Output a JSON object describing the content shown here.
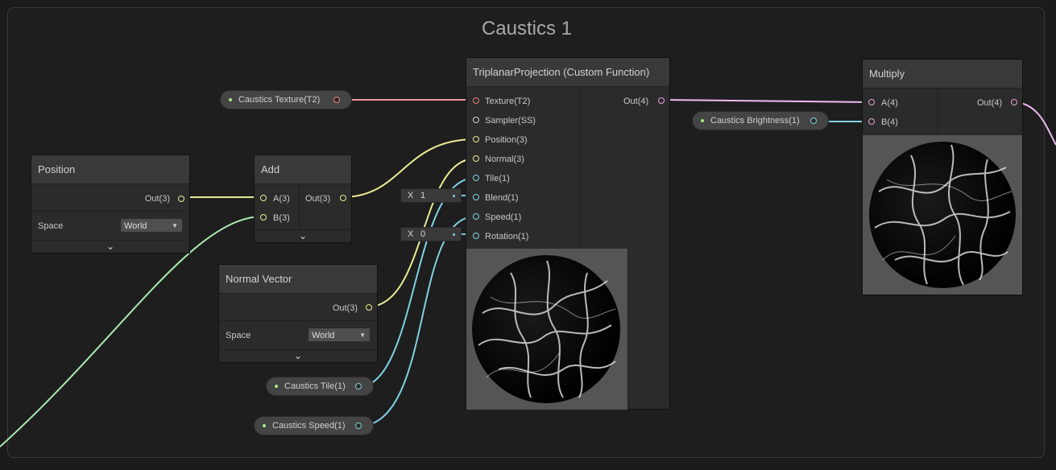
{
  "group": {
    "title": "Caustics 1"
  },
  "nodes": {
    "position": {
      "title": "Position",
      "out": "Out(3)",
      "space_label": "Space",
      "space_value": "World"
    },
    "add": {
      "title": "Add",
      "in_a": "A(3)",
      "in_b": "B(3)",
      "out": "Out(3)"
    },
    "normal_vector": {
      "title": "Normal Vector",
      "out": "Out(3)",
      "space_label": "Space",
      "space_value": "World"
    },
    "triplanar": {
      "title": "TriplanarProjection (Custom Function)",
      "inputs": [
        "Texture(T2)",
        "Sampler(SS)",
        "Position(3)",
        "Normal(3)",
        "Tile(1)",
        "Blend(1)",
        "Speed(1)",
        "Rotation(1)"
      ],
      "out": "Out(4)",
      "blend_field": {
        "axis": "X",
        "value": "1"
      },
      "rotation_field": {
        "axis": "X",
        "value": "0"
      }
    },
    "multiply": {
      "title": "Multiply",
      "in_a": "A(4)",
      "in_b": "B(4)",
      "out": "Out(4)"
    }
  },
  "properties": {
    "caustics_texture": "Caustics Texture(T2)",
    "caustics_brightness": "Caustics Brightness(1)",
    "caustics_tile": "Caustics Tile(1)",
    "caustics_speed": "Caustics Speed(1)"
  },
  "colors": {
    "vector3": "#e9eb94",
    "texture": "#ee7e7e",
    "vector4": "#e8a2e0",
    "float": "#7fd2e4",
    "wire_texture": "#ef9a9a",
    "wire_vector4": "#f0b9f0"
  },
  "icons": {
    "collapse": "chevron-down-icon",
    "dropdown": "triangle-down-icon"
  }
}
